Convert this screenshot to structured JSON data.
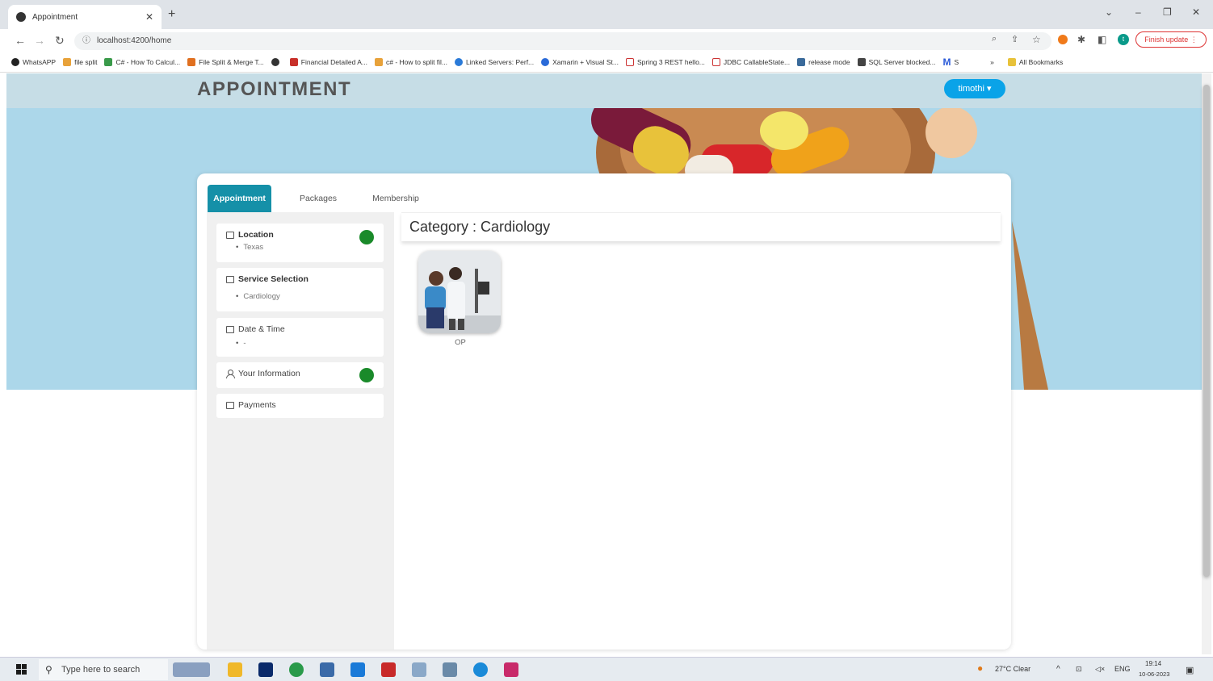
{
  "browser": {
    "tab_title": "Appointment",
    "url": "localhost:4200/home",
    "finish_update": "Finish update",
    "profile_initial": "t",
    "bookmarks": [
      "WhatsAPP",
      "file split",
      "C# - How To Calcul...",
      "File Split & Merge T...",
      "",
      "Financial Detailed A...",
      "c# - How to split fil...",
      "Linked Servers: Perf...",
      "Xamarin + Visual St...",
      "Spring 3 REST hello...",
      "JDBC CallableState...",
      "release mode",
      "SQL Server blocked...",
      "S"
    ],
    "bookmarks_more": "»",
    "all_bookmarks": "All Bookmarks"
  },
  "app": {
    "brand": "APPOINTMENT",
    "user_name": "timothi ▾"
  },
  "tabs": [
    "Appointment",
    "Packages",
    "Membership"
  ],
  "steps": [
    {
      "title": "Location",
      "value": "Texas"
    },
    {
      "title": "Service Selection",
      "value": "Cardiology"
    },
    {
      "title": "Date & Time",
      "value": "-"
    },
    {
      "title": "Your Information"
    },
    {
      "title": "Payments"
    }
  ],
  "category": {
    "heading": "Category : Cardiology"
  },
  "services": [
    {
      "label": "OP"
    }
  ],
  "colors": {
    "active_tab": "#1590a8",
    "step_done": "#1a8a2a",
    "header_bg": "#c6dde6",
    "hero_bg": "#acd7ea",
    "user_btn": "#0aa3e8"
  },
  "taskbar": {
    "search_placeholder": "Type here to search",
    "weather": "27°C  Clear",
    "lang": "ENG",
    "time": "19:14",
    "date": "10-06-2023"
  }
}
